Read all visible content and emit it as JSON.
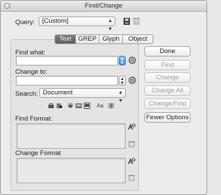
{
  "window": {
    "title": "Find/Change"
  },
  "query": {
    "label": "Query:",
    "value": "[Custom]"
  },
  "tabs": [
    {
      "label": "Text",
      "active": true
    },
    {
      "label": "GREP",
      "active": false
    },
    {
      "label": "Glyph",
      "active": false
    },
    {
      "label": "Object",
      "active": false
    }
  ],
  "find_what": {
    "label": "Find what:",
    "value": ""
  },
  "change_to": {
    "label": "Change to:",
    "value": ""
  },
  "search": {
    "label": "Search:",
    "value": "Document"
  },
  "find_format": {
    "label": "Find Format:"
  },
  "change_format": {
    "label": "Change Format"
  },
  "buttons": {
    "done": "Done",
    "find": "Find",
    "change": "Change",
    "change_all": "Change All",
    "change_find": "Change/Find",
    "fewer_options": "Fewer Options"
  },
  "option_icons": [
    "locked-layers-icon",
    "locked-stories-icon",
    "hidden-layers-icon",
    "master-pages-icon",
    "footnotes-icon",
    "case-sensitive-icon",
    "whole-word-icon"
  ],
  "option_text": {
    "case_sensitive": "Aa"
  },
  "colors": {
    "accent": "#3d8fe8",
    "disabled_text": "#9c9c9c",
    "active_tab": "#6a6a6a"
  }
}
